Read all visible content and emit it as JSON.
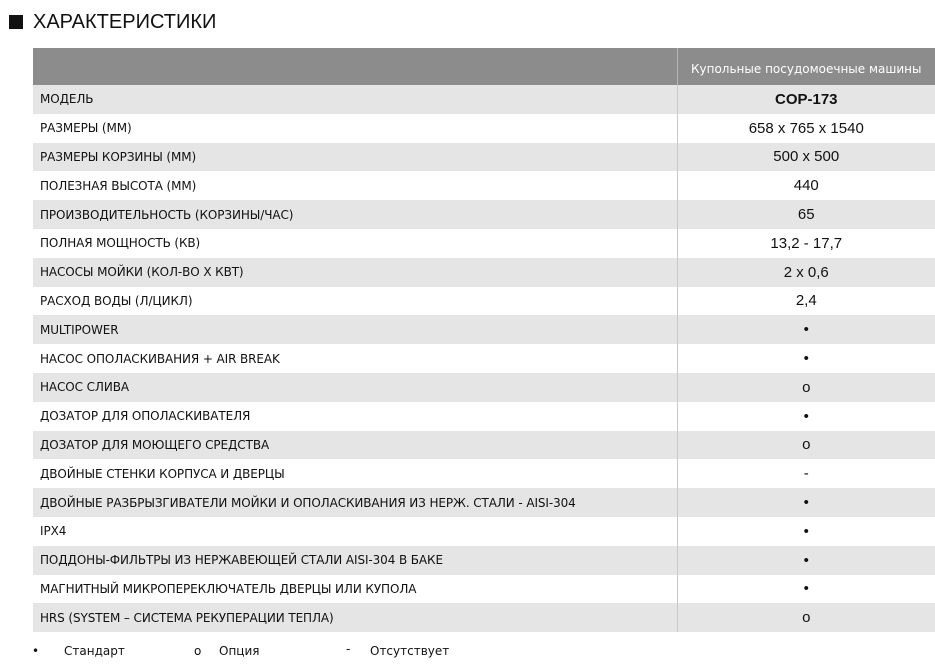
{
  "section": {
    "title": "ХАРАКТЕРИСТИКИ"
  },
  "table": {
    "column_header": "Купольные посудомоечные машины",
    "rows": [
      {
        "label": "МОДЕЛЬ",
        "value": "COP-173"
      },
      {
        "label": "РАЗМЕРЫ (ММ)",
        "value": "658 x 765 x 1540"
      },
      {
        "label": "РАЗМЕРЫ КОРЗИНЫ (ММ)",
        "value": "500 x 500"
      },
      {
        "label": "ПОЛЕЗНАЯ ВЫСОТА (ММ)",
        "value": "440"
      },
      {
        "label": "ПРОИЗВОДИТЕЛЬНОСТЬ (КОРЗИНЫ/ЧАС)",
        "value": "65"
      },
      {
        "label": "ПОЛНАЯ МОЩНОСТЬ (КВ)",
        "value": "13,2 - 17,7"
      },
      {
        "label": "НАСОСЫ МОЙКИ (КОЛ-ВО Х КВТ)",
        "value": "2 x 0,6"
      },
      {
        "label": "РАСХОД ВОДЫ  (Л/ЦИКЛ)",
        "value": "2,4"
      },
      {
        "label": "MULTIPOWER",
        "value": "•"
      },
      {
        "label": "НАСОС ОПОЛАСКИВАНИЯ + AIR BREAK",
        "value": "•"
      },
      {
        "label": "НАСОС СЛИВА",
        "value": "o"
      },
      {
        "label": "ДОЗАТОР ДЛЯ ОПОЛАСКИВАТЕЛЯ",
        "value": "•"
      },
      {
        "label": "ДОЗАТОР ДЛЯ МОЮЩЕГО СРЕДСТВА",
        "value": "o"
      },
      {
        "label": "ДВОЙНЫЕ СТЕНКИ КОРПУСА И ДВЕРЦЫ",
        "value": "-"
      },
      {
        "label": "ДВОЙНЫЕ РАЗБРЫЗГИВАТЕЛИ МОЙКИ И ОПОЛАСКИВАНИЯ ИЗ НЕРЖ. СТАЛИ - AISI-304",
        "value": "•"
      },
      {
        "label": "IPX4",
        "value": "•"
      },
      {
        "label": "ПОДДОНЫ-ФИЛЬТРЫ ИЗ НЕРЖАВЕЮЩЕЙ СТАЛИ AISI-304 В БАКЕ",
        "value": "•"
      },
      {
        "label": "МАГНИТНЫЙ МИКРОПЕРЕКЛЮЧАТЕЛЬ ДВЕРЦЫ ИЛИ КУПОЛА",
        "value": "•"
      },
      {
        "label": "HRS (SYSTEM – СИСТЕМА РЕКУПЕРАЦИИ ТЕПЛА)",
        "value": "o"
      }
    ]
  },
  "legend": {
    "standard_symbol": "•",
    "standard_label": "Стандарт",
    "option_symbol": "o",
    "option_label": "Опция",
    "absent_symbol": "-",
    "absent_label": "Отсутствует"
  },
  "colors": {
    "header_bg": "#8c8c8c",
    "stripe_bg": "#e5e5e5",
    "text": "#111111"
  }
}
